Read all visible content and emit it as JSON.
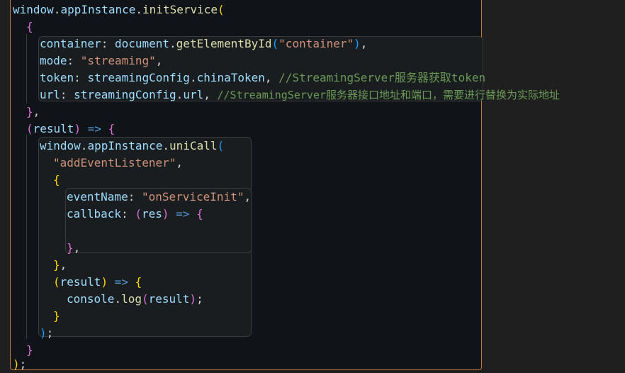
{
  "code": {
    "window": "window",
    "appInstance": "appInstance",
    "initService": "initService",
    "uniCall": "uniCall",
    "container_key": "container",
    "document": "document",
    "getElementById": "getElementById",
    "container_str": "\"container\"",
    "mode_key": "mode",
    "mode_val": "\"streaming\"",
    "token_key": "token",
    "streamingConfig": "streamingConfig",
    "chinaToken": "chinaToken",
    "token_comment": "//StreamingServer服务器获取token",
    "url_key": "url",
    "url_prop": "url",
    "url_comment": "//StreamingServer服务器接口地址和端口，需要进行替换为实际地址",
    "result": "result",
    "addEventListener": "\"addEventListener\"",
    "eventName_key": "eventName",
    "eventName_val": "\"onServiceInit\"",
    "callback_key": "callback",
    "res": "res",
    "console": "console",
    "log": "log"
  }
}
